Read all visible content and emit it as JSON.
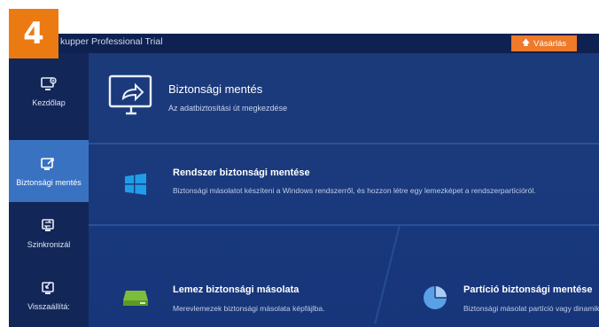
{
  "step_number": "4",
  "app": {
    "title": "kupper Professional Trial",
    "buy_label": "Vásárlás"
  },
  "sidebar": {
    "items": [
      {
        "label": "Kezdőlap",
        "icon": "home-monitor-icon",
        "active": false
      },
      {
        "label": "Biztonsági mentés",
        "icon": "backup-icon",
        "active": true
      },
      {
        "label": "Szinkronizál",
        "icon": "sync-icon",
        "active": false
      },
      {
        "label": "Visszaállítá:",
        "icon": "restore-icon",
        "active": false
      }
    ]
  },
  "header": {
    "title": "Biztonsági mentés",
    "subtitle": "Az adatbiztosítási út megkezdése",
    "icon": "monitor-share-icon"
  },
  "cards": {
    "system": {
      "title": "Rendszer biztonsági mentése",
      "desc": "Biztonsági másolatot készíteni a Windows rendszerről, és hozzon létre egy lemezképet a rendszerpartícióról.",
      "icon": "windows-icon"
    },
    "disk": {
      "title": "Lemez biztonsági másolata",
      "desc": "Merevlemezek biztonsági másolata képfájlba.",
      "icon": "disk-drive-icon"
    },
    "partition": {
      "title": "Partíció biztonsági mentése",
      "desc": "Biztonsági másolat partíció vagy dinamikus kötet",
      "icon": "pie-partition-icon"
    }
  },
  "colors": {
    "accent_orange": "#ec7a12",
    "app_bg": "#14295c",
    "active_item": "#3a72c2",
    "windows_blue": "#1e9ee8",
    "disk_green": "#7cbd3b",
    "pie_blue": "#5aa0e6"
  }
}
